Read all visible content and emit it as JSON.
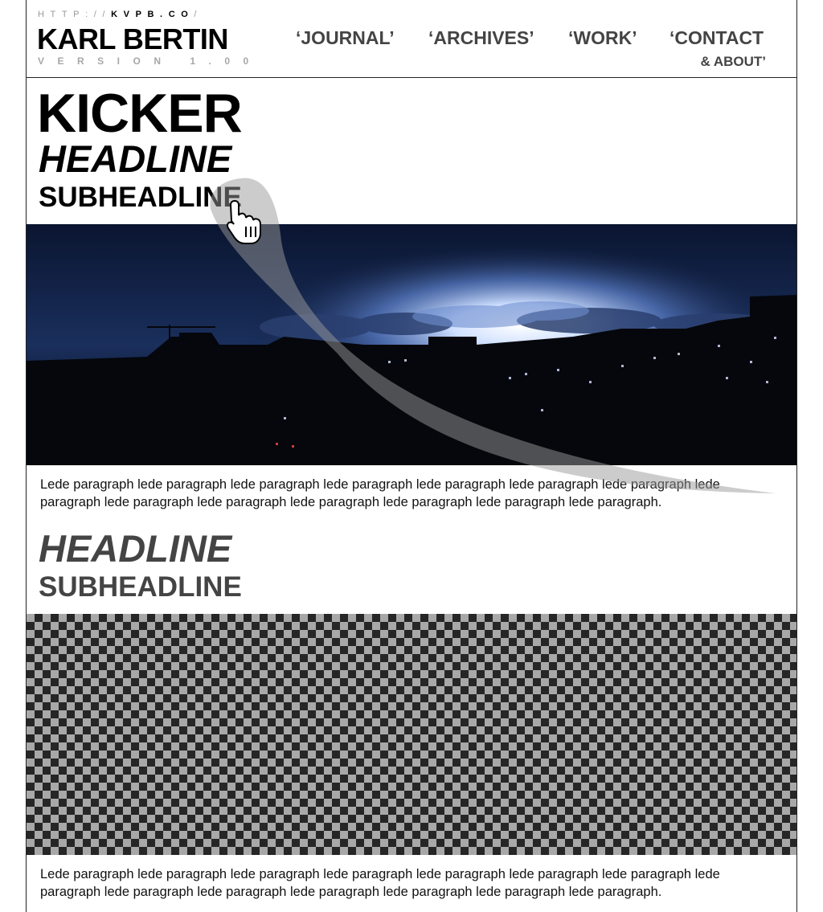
{
  "header": {
    "url_prefix": "HTTP://",
    "url_domain": "KVPB.CO",
    "url_suffix": "/",
    "title": "KARL BERTIN",
    "version": "VERSION 1.00"
  },
  "nav": {
    "journal": "‘JOURNAL’",
    "archives": "‘ARCHIVES’",
    "work": "‘WORK’",
    "contact": "‘CONTACT",
    "contact_sub": "& ABOUT’"
  },
  "article1": {
    "kicker": "KICKER",
    "headline": "HEADLINE",
    "subheadline": "SUBHEADLINE",
    "lede": "Lede paragraph lede paragraph lede paragraph lede paragraph lede paragraph lede paragraph lede paragraph lede paragraph lede paragraph lede paragraph lede paragraph lede paragraph lede paragraph lede paragraph."
  },
  "article2": {
    "headline": "HEADLINE",
    "subheadline": "SUBHEADLINE",
    "lede": "Lede paragraph lede paragraph lede paragraph lede paragraph lede paragraph lede paragraph lede paragraph lede paragraph lede paragraph lede paragraph lede paragraph lede paragraph lede paragraph lede paragraph."
  },
  "colors": {
    "text": "#000000",
    "muted_text": "#444444",
    "url_muted": "#9a9a9a",
    "border": "#222222",
    "checker_dark": "#262626",
    "checker_light": "#a8a8a8"
  },
  "icons": {
    "cursor": "hand-pointer-icon",
    "gesture": "swipe-trail"
  }
}
